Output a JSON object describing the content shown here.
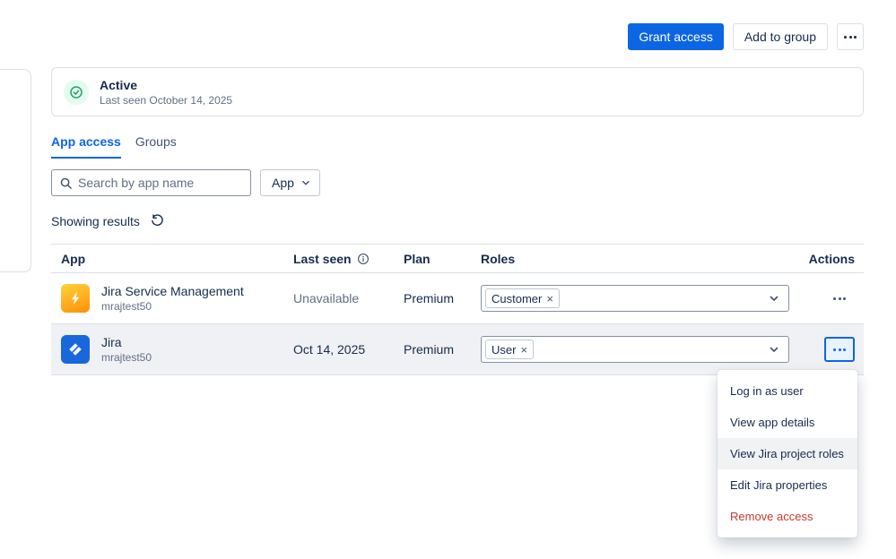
{
  "toolbar": {
    "grant_access_label": "Grant access",
    "add_to_group_label": "Add to group"
  },
  "status_card": {
    "title": "Active",
    "subtitle": "Last seen October 14, 2025"
  },
  "tabs": {
    "app_access": "App access",
    "groups": "Groups"
  },
  "filters": {
    "search_placeholder": "Search by app name",
    "app_dropdown_label": "App"
  },
  "results_label": "Showing results",
  "table": {
    "headers": {
      "app": "App",
      "last_seen": "Last seen",
      "plan": "Plan",
      "roles": "Roles",
      "actions": "Actions"
    },
    "rows": [
      {
        "name": "Jira Service Management",
        "subtitle": "mrajtest50",
        "last_seen": "Unavailable",
        "plan": "Premium",
        "role": "Customer"
      },
      {
        "name": "Jira",
        "subtitle": "mrajtest50",
        "last_seen": "Oct 14, 2025",
        "plan": "Premium",
        "role": "User"
      }
    ]
  },
  "context_menu": {
    "items": [
      "Log in as user",
      "View app details",
      "View Jira project roles",
      "Edit Jira properties",
      "Remove access"
    ]
  },
  "glyphs": {
    "remove_tag": "×"
  },
  "colors": {
    "primary": "#0C66E4",
    "danger": "#C9372C",
    "success": "#22A06B",
    "selected_row": "#F0F1F4"
  }
}
